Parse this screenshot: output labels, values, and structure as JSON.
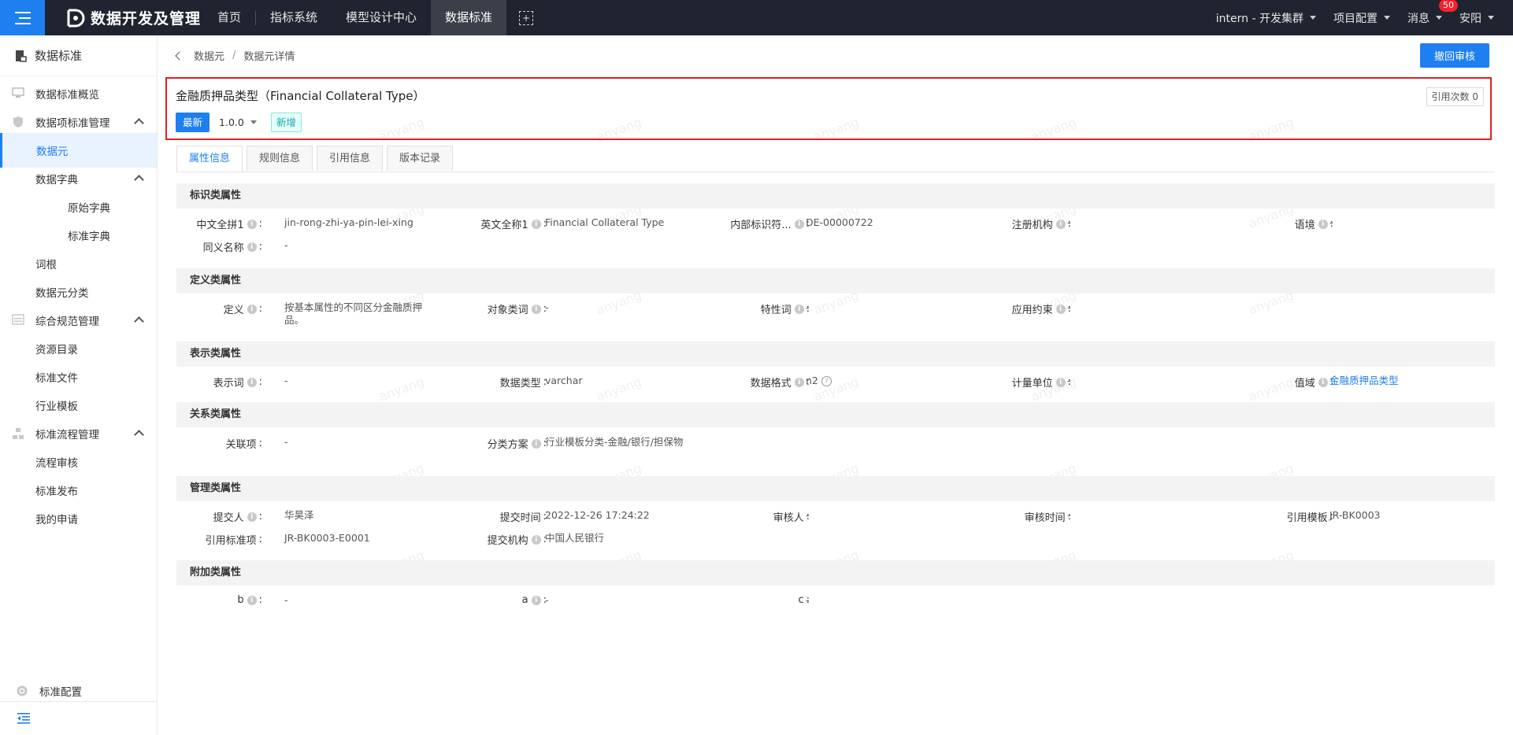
{
  "app": {
    "title": "数据开发及管理",
    "nav": [
      "首页",
      "指标系统",
      "模型设计中心",
      "数据标准"
    ],
    "cluster": "intern - 开发集群",
    "project_config": "项目配置",
    "messages": "消息",
    "message_badge": "50",
    "user": "安阳"
  },
  "sidebar": {
    "header": "数据标准",
    "items": [
      {
        "label": "数据标准概览"
      },
      {
        "label": "数据项标准管理"
      },
      {
        "label": "数据元"
      },
      {
        "label": "数据字典"
      },
      {
        "label": "原始字典"
      },
      {
        "label": "标准字典"
      },
      {
        "label": "词根"
      },
      {
        "label": "数据元分类"
      },
      {
        "label": "综合规范管理"
      },
      {
        "label": "资源目录"
      },
      {
        "label": "标准文件"
      },
      {
        "label": "行业模板"
      },
      {
        "label": "标准流程管理"
      },
      {
        "label": "流程审核"
      },
      {
        "label": "标准发布"
      },
      {
        "label": "我的申请"
      }
    ],
    "config": "标准配置"
  },
  "breadcrumb": [
    "数据元",
    "数据元详情"
  ],
  "withdraw_button": "撤回审核",
  "detail": {
    "title": "金融质押品类型（Financial Collateral Type）",
    "tag_latest": "最新",
    "version": "1.0.0",
    "tag_new": "新增",
    "ref_count": "引用次数 0"
  },
  "tabs": [
    "属性信息",
    "规则信息",
    "引用信息",
    "版本记录"
  ],
  "watermark": "anyang",
  "sections": {
    "identification": {
      "title": "标识类属性",
      "fields": [
        {
          "label": "中文全拼1",
          "value": "jin-rong-zhi-ya-pin-lei-xing"
        },
        {
          "label": "英文全称1",
          "value": "Financial Collateral Type"
        },
        {
          "label": "内部标识符...",
          "value": "DE-00000722"
        },
        {
          "label": "注册机构",
          "value": "-"
        },
        {
          "label": "语境",
          "value": "-"
        },
        {
          "label": "同义名称",
          "value": "-"
        }
      ]
    },
    "definition": {
      "title": "定义类属性",
      "fields": [
        {
          "label": "定义",
          "value": "按基本属性的不同区分金融质押品。"
        },
        {
          "label": "对象类词",
          "value": "-"
        },
        {
          "label": "特性词",
          "value": "-"
        },
        {
          "label": "应用约束",
          "value": "-"
        }
      ]
    },
    "representation": {
      "title": "表示类属性",
      "fields": [
        {
          "label": "表示词",
          "value": "-"
        },
        {
          "label": "数据类型",
          "value": "varchar"
        },
        {
          "label": "数据格式",
          "value": "n2"
        },
        {
          "label": "计量单位",
          "value": "-"
        },
        {
          "label": "值域",
          "value": "金融质押品类型"
        }
      ]
    },
    "relation": {
      "title": "关系类属性",
      "fields": [
        {
          "label": "关联项",
          "value": "-"
        },
        {
          "label": "分类方案",
          "value": "行业模板分类-金融/银行/担保物"
        }
      ]
    },
    "management": {
      "title": "管理类属性",
      "fields": [
        {
          "label": "提交人",
          "value": "华昊泽"
        },
        {
          "label": "提交时间",
          "value": "2022-12-26 17:24:22"
        },
        {
          "label": "审核人",
          "value": "-"
        },
        {
          "label": "审核时间",
          "value": "-"
        },
        {
          "label": "引用模板",
          "value": "JR-BK0003"
        },
        {
          "label": "引用标准项",
          "value": "JR-BK0003-E0001"
        },
        {
          "label": "提交机构",
          "value": "中国人民银行"
        }
      ]
    },
    "additional": {
      "title": "附加类属性",
      "fields": [
        {
          "label": "b",
          "value": "-"
        },
        {
          "label": "a",
          "value": "-"
        },
        {
          "label": "c",
          "value": "-"
        }
      ]
    }
  }
}
